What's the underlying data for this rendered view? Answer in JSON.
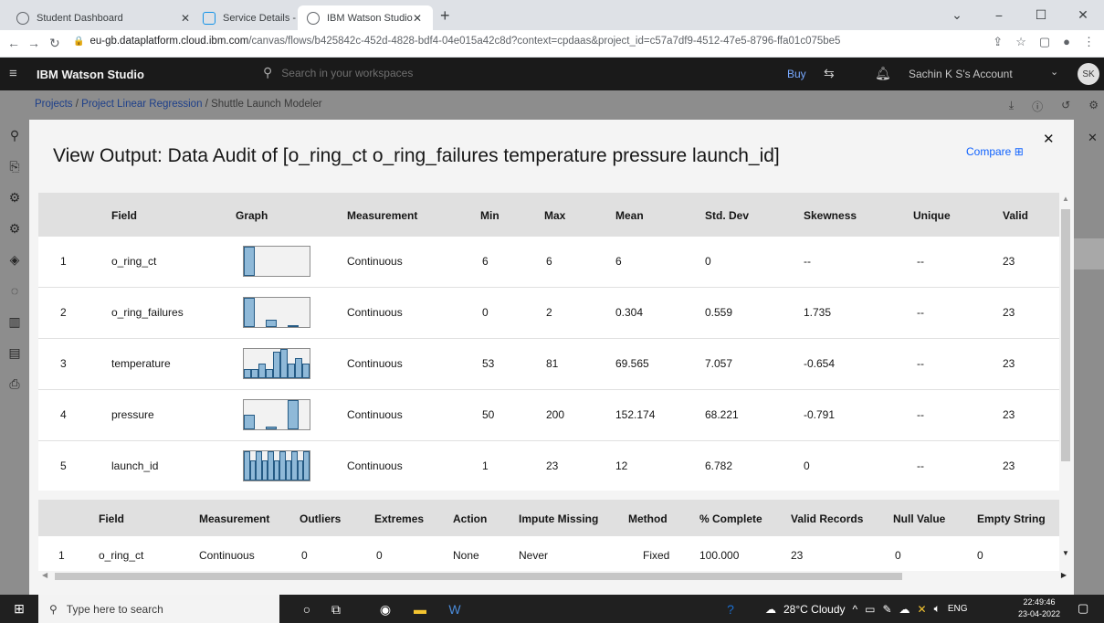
{
  "browser": {
    "tabs": [
      {
        "title": "Student Dashboard",
        "active": false
      },
      {
        "title": "Service Details - IBM Cloud",
        "active": false
      },
      {
        "title": "IBM Watson Studio",
        "active": true
      }
    ],
    "url_host": "eu-gb.dataplatform.cloud.ibm.com",
    "url_path": "/canvas/flows/b425842c-452d-4828-bdf4-04e015a42c8d?context=cpdaas&project_id=c57a7df9-4512-47e5-8796-ffa01c075be5"
  },
  "app": {
    "brand": "IBM Watson Studio",
    "search_placeholder": "Search in your workspaces",
    "buy": "Buy",
    "account": "Sachin K S's Account",
    "avatar_initials": "SK"
  },
  "breadcrumb": {
    "projects": "Projects",
    "project": "Project Linear Regression",
    "current": "Shuttle Launch Modeler",
    "sep": "/"
  },
  "modal": {
    "title": "View Output: Data Audit of [o_ring_ct o_ring_failures temperature pressure launch_id]",
    "compare": "Compare"
  },
  "audit_table": {
    "headers": {
      "field": "Field",
      "graph": "Graph",
      "measurement": "Measurement",
      "min": "Min",
      "max": "Max",
      "mean": "Mean",
      "std": "Std. Dev",
      "skewness": "Skewness",
      "unique": "Unique",
      "valid": "Valid"
    },
    "rows": [
      {
        "num": "1",
        "field": "o_ring_ct",
        "measurement": "Continuous",
        "min": "6",
        "max": "6",
        "mean": "6",
        "std": "0",
        "skewness": "--",
        "unique": "--",
        "valid": "23",
        "hist": [
          1.0
        ]
      },
      {
        "num": "2",
        "field": "o_ring_failures",
        "measurement": "Continuous",
        "min": "0",
        "max": "2",
        "mean": "0.304",
        "std": "0.559",
        "skewness": "1.735",
        "unique": "--",
        "valid": "23",
        "hist": [
          1.0,
          0,
          0.25,
          0,
          0.05
        ]
      },
      {
        "num": "3",
        "field": "temperature",
        "measurement": "Continuous",
        "min": "53",
        "max": "81",
        "mean": "69.565",
        "std": "7.057",
        "skewness": "-0.654",
        "unique": "--",
        "valid": "23",
        "hist": [
          0.3,
          0.3,
          0.5,
          0.3,
          0.9,
          1.0,
          0.5,
          0.7,
          0.5
        ]
      },
      {
        "num": "4",
        "field": "pressure",
        "measurement": "Continuous",
        "min": "50",
        "max": "200",
        "mean": "152.174",
        "std": "68.221",
        "skewness": "-0.791",
        "unique": "--",
        "valid": "23",
        "hist": [
          0.5,
          0,
          0.1,
          0,
          1.0
        ]
      },
      {
        "num": "5",
        "field": "launch_id",
        "measurement": "Continuous",
        "min": "1",
        "max": "23",
        "mean": "12",
        "std": "6.782",
        "skewness": "0",
        "unique": "--",
        "valid": "23",
        "hist": [
          1.0,
          0.7,
          1.0,
          0.7,
          1.0,
          0.7,
          1.0,
          0.7,
          1.0,
          0.7,
          1.0
        ]
      }
    ]
  },
  "quality_table": {
    "headers": {
      "field": "Field",
      "measurement": "Measurement",
      "outliers": "Outliers",
      "extremes": "Extremes",
      "action": "Action",
      "impute": "Impute Missing",
      "method": "Method",
      "complete": "% Complete",
      "valid_records": "Valid Records",
      "null_value": "Null Value",
      "empty_string": "Empty String"
    },
    "rows": [
      {
        "num": "1",
        "field": "o_ring_ct",
        "measurement": "Continuous",
        "outliers": "0",
        "extremes": "0",
        "action": "None",
        "impute": "Never",
        "method": "Fixed",
        "complete": "100.000",
        "valid_records": "23",
        "null_value": "0",
        "empty_string": "0"
      }
    ]
  },
  "taskbar": {
    "search_placeholder": "Type here to search",
    "weather": "28°C  Cloudy",
    "lang": "ENG",
    "time": "22:49:46",
    "date": "23-04-2022"
  },
  "colors": {
    "hist_fill": "#8fb9d8",
    "hist_stroke": "#245a84",
    "link_blue": "#0f62fe"
  }
}
